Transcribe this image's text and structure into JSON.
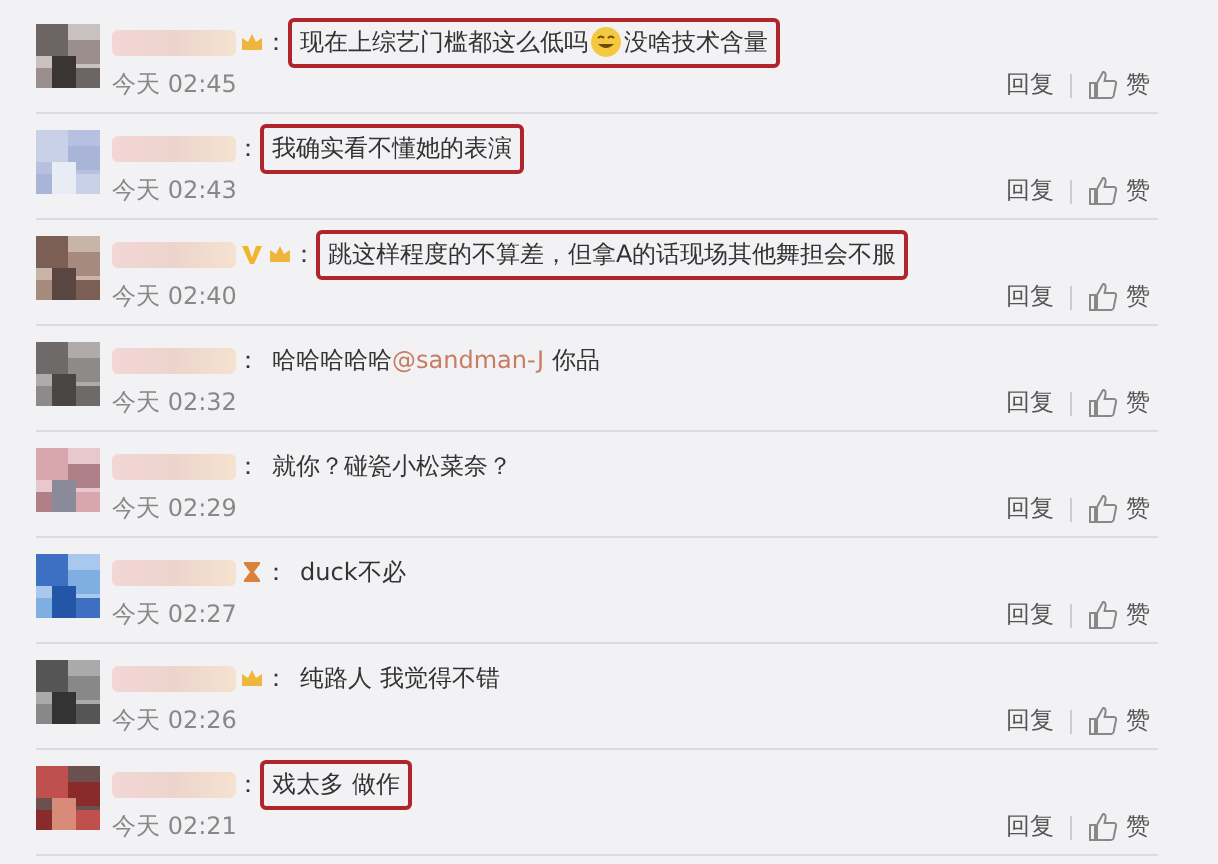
{
  "comments": [
    {
      "avatar": {
        "kind": "picture"
      },
      "badges": [
        {
          "kind": "crown"
        }
      ],
      "colon": "：",
      "highlighted": true,
      "content": [
        {
          "kind": "text",
          "text": "现在上综艺门槛都这么低吗"
        },
        {
          "kind": "emoji"
        },
        {
          "kind": "text",
          "text": "没啥技术含量"
        }
      ],
      "time": "今天 02:45",
      "reply": "回复",
      "like": "赞"
    },
    {
      "avatar": {
        "kind": "picture"
      },
      "colon": "：",
      "highlighted": true,
      "content": [
        {
          "kind": "text",
          "text": "我确实看不懂她的表演"
        }
      ],
      "time": "今天 02:43",
      "reply": "回复",
      "like": "赞"
    },
    {
      "avatar": {
        "kind": "picture"
      },
      "badges": [
        {
          "kind": "verified"
        },
        {
          "kind": "crown"
        }
      ],
      "colon": "：",
      "highlighted": true,
      "content": [
        {
          "kind": "text",
          "text": "跳这样程度的不算差，但拿A的话现场其他舞担会不服"
        }
      ],
      "time": "今天 02:40",
      "reply": "回复",
      "like": "赞"
    },
    {
      "avatar": {
        "kind": "picture"
      },
      "colon": "：",
      "highlighted": false,
      "content": [
        {
          "kind": "text",
          "text": "哈哈哈哈哈"
        },
        {
          "kind": "mention",
          "text": "@sandman-J"
        },
        {
          "kind": "text",
          "text": " 你品"
        }
      ],
      "time": "今天 02:32",
      "reply": "回复",
      "like": "赞"
    },
    {
      "avatar": {
        "kind": "picture"
      },
      "colon": "：",
      "highlighted": false,
      "content": [
        {
          "kind": "text",
          "text": "就你？碰瓷小松菜奈？"
        }
      ],
      "time": "今天 02:29",
      "reply": "回复",
      "like": "赞"
    },
    {
      "avatar": {
        "kind": "picture"
      },
      "badges": [
        {
          "kind": "hourglass"
        }
      ],
      "colon": "：",
      "highlighted": false,
      "content": [
        {
          "kind": "text",
          "text": "duck不必"
        }
      ],
      "time": "今天 02:27",
      "reply": "回复",
      "like": "赞"
    },
    {
      "avatar": {
        "kind": "picture"
      },
      "badges": [
        {
          "kind": "crown"
        }
      ],
      "colon": "：",
      "highlighted": false,
      "content": [
        {
          "kind": "text",
          "text": "纯路人 我觉得不错"
        }
      ],
      "time": "今天 02:26",
      "reply": "回复",
      "like": "赞"
    },
    {
      "avatar": {
        "kind": "picture"
      },
      "colon": "：",
      "highlighted": true,
      "content": [
        {
          "kind": "text",
          "text": "戏太多 做作"
        }
      ],
      "time": "今天 02:21",
      "reply": "回复",
      "like": "赞"
    }
  ]
}
